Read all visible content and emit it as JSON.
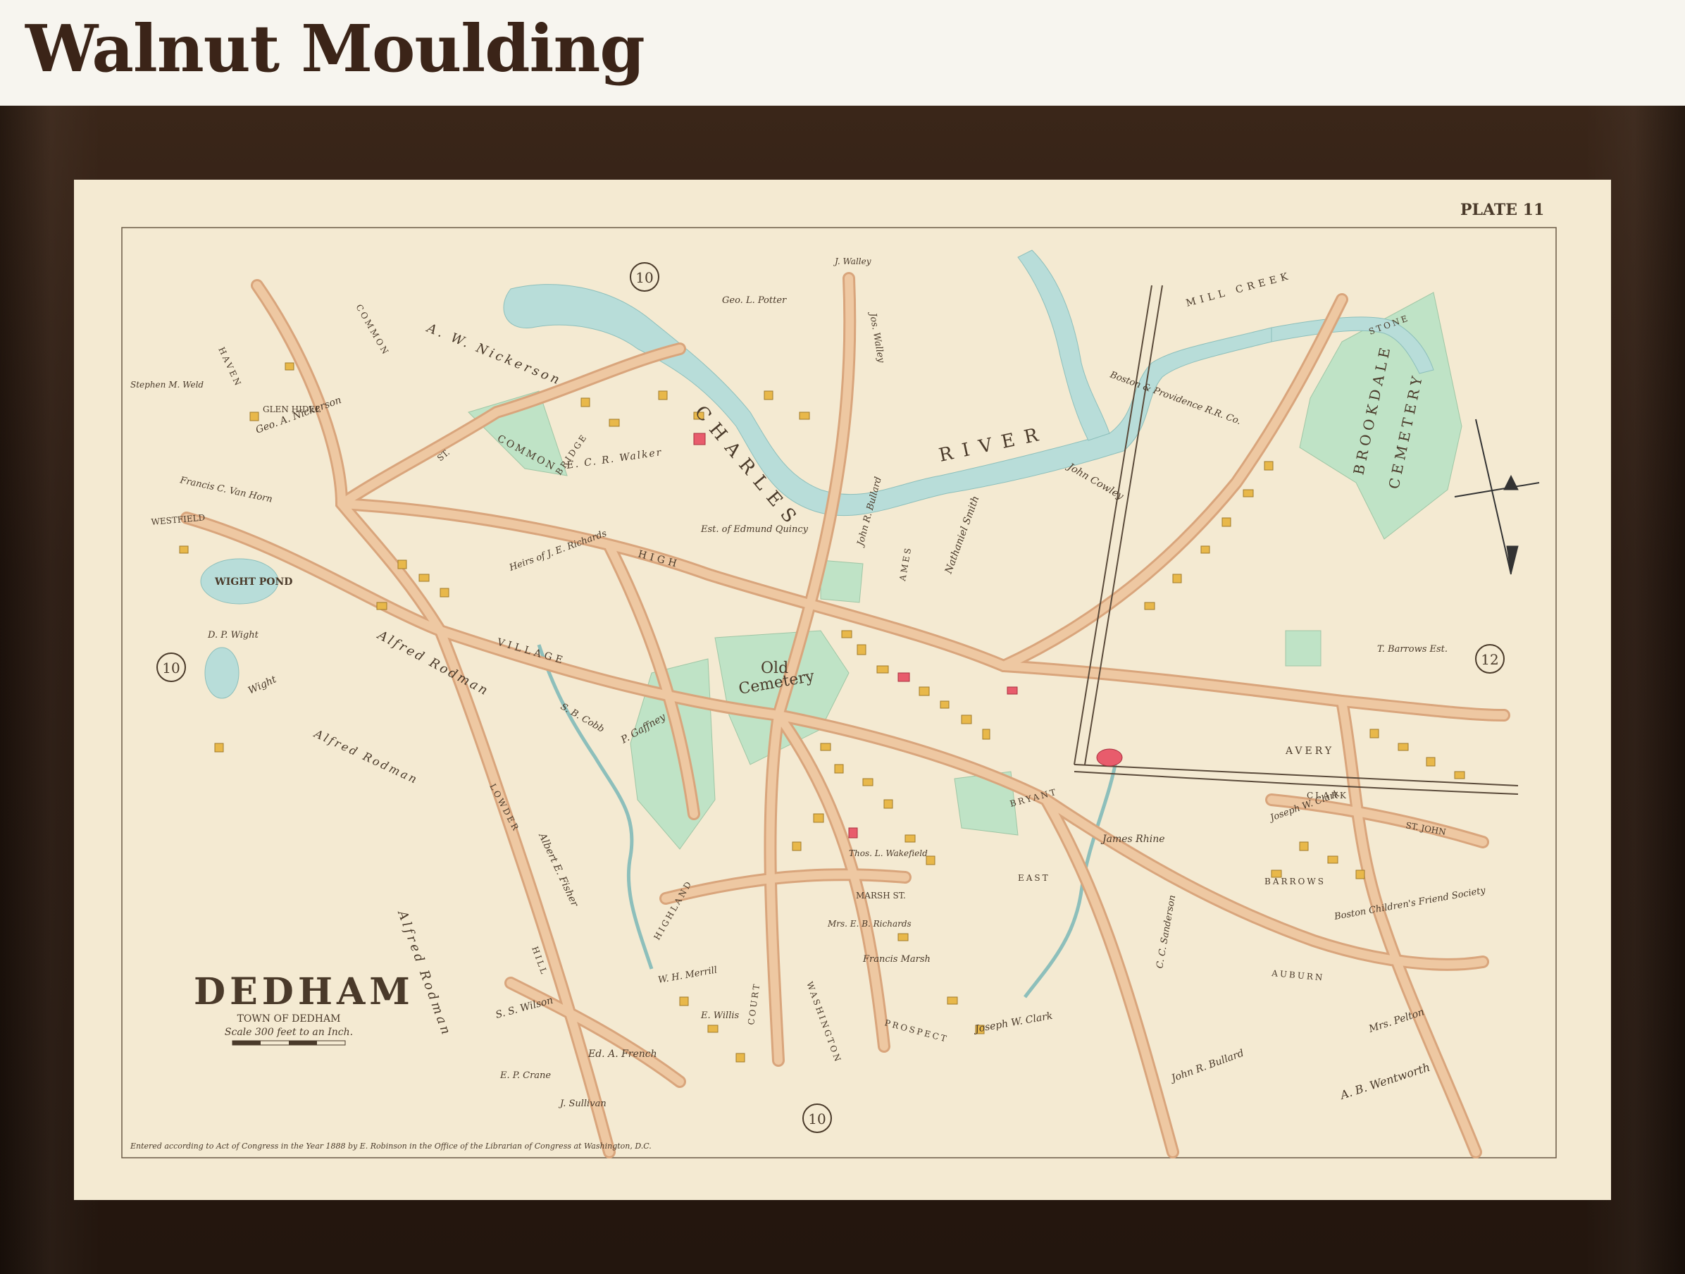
{
  "header": {
    "title": "Walnut Moulding"
  },
  "map": {
    "plate": "PLATE 11",
    "title": "DEDHAM",
    "subtitle": "TOWN OF DEDHAM",
    "scale": "Scale 300 feet to an Inch.",
    "copyright": "Entered according to Act of Congress in the Year 1888 by E. Robinson in the Office of the Librarian of Congress at Washington, D.C.",
    "plate_refs": [
      "10",
      "10",
      "10",
      "12"
    ],
    "water_labels": [
      "CHARLES",
      "RIVER",
      "WIGHT POND",
      "MILL CREEK"
    ],
    "cemeteries": [
      "BROOKDALE",
      "CEMETERY",
      "Old",
      "Cemetery"
    ],
    "places": [
      "COMMON",
      "GLEN HIDEL"
    ],
    "streets": [
      "HIGH",
      "VILLAGE",
      "WESTFIELD",
      "HAVEN",
      "COMMON",
      "BRIDGE",
      "ST.",
      "AMES",
      "LOWDER",
      "AVERY",
      "CLARK",
      "BRYANT",
      "AUBURN",
      "MARSH ST.",
      "COURT",
      "WASHINGTON",
      "PROSPECT",
      "HIGHLAND",
      "HILL",
      "BARROWS",
      "STONE",
      "EAST",
      "ST. JOHN"
    ],
    "owners": [
      "A. W. Nickerson",
      "Geo. A. Nickerson",
      "Stephen M. Weld",
      "Francis C. Van Horn",
      "D. P. Wight",
      "Alfred Rodman",
      "Alfred Rodman",
      "Alfred Rodman",
      "E. C. R. Walker",
      "Est. of Edmund Quincy",
      "Heirs of J. E. Richards",
      "S. B. Cobb",
      "P. Gaffney",
      "Albert E. Fisher",
      "S. S. Wilson",
      "E. P. Crane",
      "J. Sullivan",
      "Ed. A. French",
      "W. H. Merrill",
      "E. Willis",
      "John R. Bullard",
      "James Rhine",
      "John Cowley",
      "Nathaniel Smith",
      "Joseph W. Clark",
      "John R. Bullard",
      "A. B. Wentworth",
      "Mrs. Pelton",
      "Boston Children's Friend Society",
      "Boston & Providence R.R. Co.",
      "Geo. L. Potter",
      "Thos. L. Wakefield",
      "Mrs. E. B. Richards",
      "Francis Marsh",
      "Jos. Walley",
      "J. Walley",
      "T. Barrows Est.",
      "Wight",
      "Joseph W. Clark",
      "C. C. Sanderson"
    ]
  },
  "colors": {
    "paper": "#f4ead2",
    "road": "#eec8a2",
    "road_edge": "#d9a57c",
    "water": "#b8ddd9",
    "park": "#bfe3c6",
    "building": "#e8b84a",
    "frame": "#2c1b12"
  }
}
